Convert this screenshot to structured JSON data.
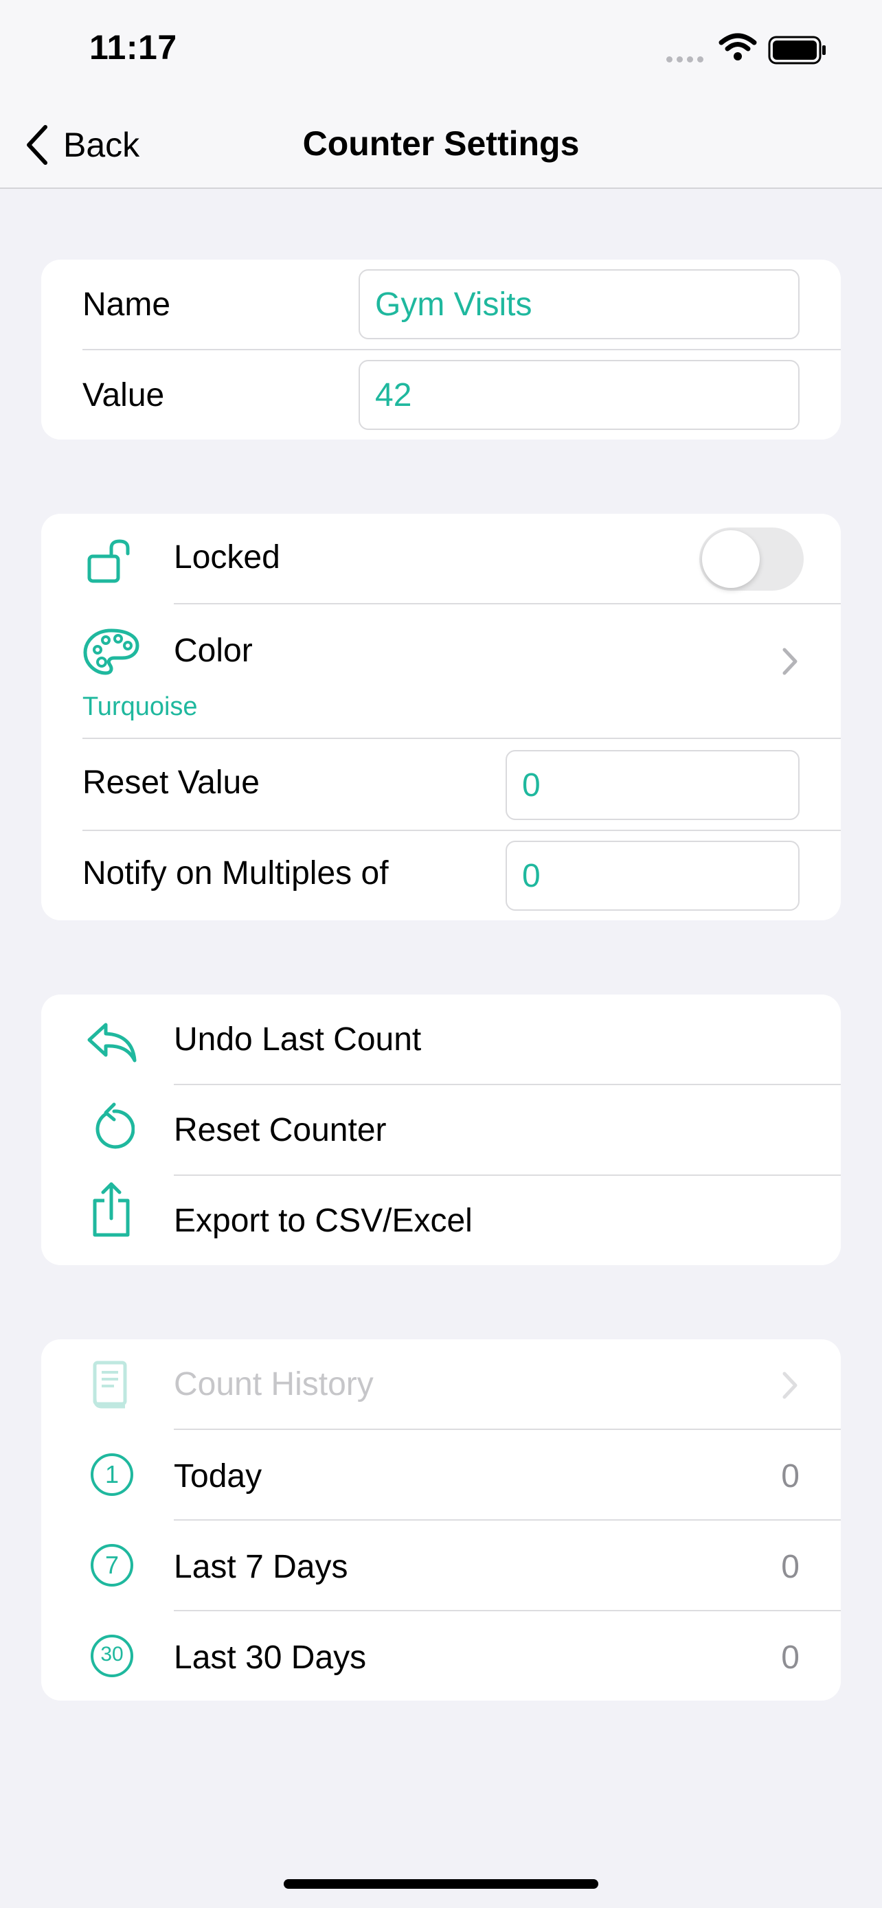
{
  "status_bar": {
    "time": "11:17"
  },
  "nav": {
    "back_label": "Back",
    "title": "Counter Settings"
  },
  "details": {
    "name_label": "Name",
    "name_value": "Gym Visits",
    "value_label": "Value",
    "value_value": "42"
  },
  "settings": {
    "locked_label": "Locked",
    "locked_on": false,
    "color_label": "Color",
    "color_value": "Turquoise",
    "reset_value_label": "Reset Value",
    "reset_value": "0",
    "notify_label": "Notify on Multiples of",
    "notify_value": "0"
  },
  "actions": {
    "undo_label": "Undo Last Count",
    "reset_label": "Reset Counter",
    "export_label": "Export to CSV/Excel"
  },
  "history": {
    "title": "Count History",
    "rows": [
      {
        "icon": "1",
        "label": "Today",
        "count": "0"
      },
      {
        "icon": "7",
        "label": "Last 7 Days",
        "count": "0"
      },
      {
        "icon": "30",
        "label": "Last 30 Days",
        "count": "0"
      }
    ]
  },
  "colors": {
    "accent": "#1fb89e",
    "background": "#f2f2f7",
    "secondary_text": "#8e8e93"
  }
}
